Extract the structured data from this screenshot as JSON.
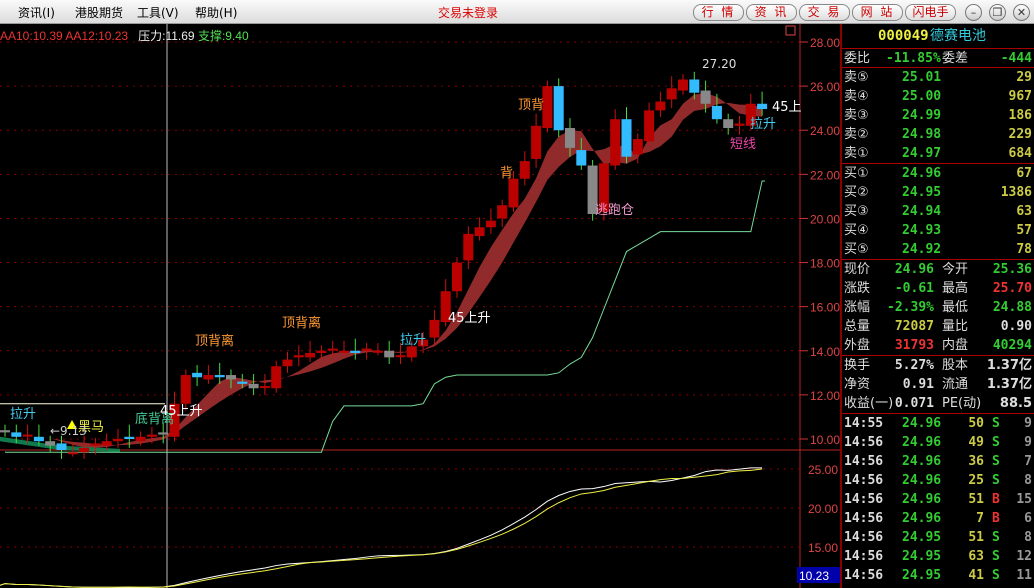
{
  "menu": [
    "资讯(I)",
    "港股期货",
    "工具(V)",
    "帮助(H)"
  ],
  "login_status": "交易未登录",
  "top_buttons": [
    "行 情",
    "资 讯",
    "交 易",
    "网 站",
    "闪电手"
  ],
  "window_buttons": [
    "minimize",
    "restore",
    "close"
  ],
  "legend": {
    "aa10": "AA10:10.39",
    "aa12": "AA12:10.23",
    "pressure": "压力:11.69",
    "support": "支撑:9.40"
  },
  "annotations": {
    "dingbeili1": "顶背离",
    "dingbeili2": "顶背离",
    "dingbeili3": "顶背",
    "dingbeili4": "顶背离",
    "dibeili": "底背离",
    "heima": "黑马",
    "low": "←9.13",
    "high": "27.20",
    "up45a": "45上升",
    "up45b": "45上升",
    "up45c": "45上",
    "lasheng1": "拉升",
    "lasheng2": "拉升",
    "lasheng3": "拉升",
    "duanxian": "短线",
    "taopao": "逃跑仓",
    "beibei": "背"
  },
  "chart_data": {
    "type": "candlestick",
    "closes": [
      10.3,
      10.1,
      10.2,
      9.9,
      9.7,
      9.5,
      9.4,
      9.6,
      9.8,
      9.9,
      10.0,
      10.0,
      10.1,
      10.2,
      10.2,
      11.6,
      12.9,
      12.8,
      12.9,
      12.8,
      12.7,
      12.5,
      12.3,
      12.4,
      13.3,
      13.6,
      13.8,
      13.9,
      14.0,
      14.1,
      14.0,
      13.9,
      14.1,
      14.0,
      13.7,
      13.8,
      14.2,
      14.5,
      15.4,
      16.7,
      18.0,
      19.3,
      19.6,
      19.9,
      20.6,
      21.8,
      22.6,
      24.2,
      26.0,
      24.0,
      23.2,
      22.4,
      20.2,
      22.5,
      24.5,
      22.8,
      23.6,
      24.9,
      25.3,
      25.9,
      26.3,
      25.7,
      25.2,
      24.5,
      24.1,
      24.3,
      25.2,
      24.96
    ],
    "price_ticks": [
      "28.00",
      "26.00",
      "24.00",
      "22.00",
      "20.00",
      "18.00",
      "16.00",
      "14.00",
      "12.00",
      "10.00"
    ],
    "price_range": [
      10,
      28
    ],
    "lower_ticks": [
      "25.00",
      "20.00",
      "15.00"
    ],
    "lower_current": "10.23"
  },
  "quote": {
    "code": "000049",
    "name": "德赛电池",
    "weibi_label": "委比",
    "weibi": "-11.85%",
    "weicha_label": "委差",
    "weicha": "-444",
    "sell": [
      [
        "卖⑤",
        "25.01",
        "29"
      ],
      [
        "卖④",
        "25.00",
        "967"
      ],
      [
        "卖③",
        "24.99",
        "186"
      ],
      [
        "卖②",
        "24.98",
        "229"
      ],
      [
        "卖①",
        "24.97",
        "684"
      ]
    ],
    "buy": [
      [
        "买①",
        "24.96",
        "67"
      ],
      [
        "买②",
        "24.95",
        "1386"
      ],
      [
        "买③",
        "24.94",
        "63"
      ],
      [
        "买④",
        "24.93",
        "57"
      ],
      [
        "买⑤",
        "24.92",
        "78"
      ]
    ],
    "stats": [
      [
        "现价",
        "24.96",
        "今开",
        "25.36"
      ],
      [
        "涨跌",
        "-0.61",
        "最高",
        "25.70"
      ],
      [
        "涨幅",
        "-2.39%",
        "最低",
        "24.88"
      ],
      [
        "总量",
        "72087",
        "量比",
        "0.90"
      ],
      [
        "外盘",
        "31793",
        "内盘",
        "40294"
      ]
    ],
    "stats2": [
      [
        "换手",
        "5.27%",
        "股本",
        "1.37亿"
      ],
      [
        "净资",
        "0.91",
        "流通",
        "1.37亿"
      ],
      [
        "收益(一)",
        "0.071",
        "PE(动)",
        "88.5"
      ]
    ],
    "ticks": [
      [
        "14:55",
        "24.96",
        "50",
        "S",
        "9"
      ],
      [
        "14:56",
        "24.96",
        "49",
        "S",
        "9"
      ],
      [
        "14:56",
        "24.96",
        "36",
        "S",
        "7"
      ],
      [
        "14:56",
        "24.96",
        "25",
        "S",
        "8"
      ],
      [
        "14:56",
        "24.96",
        "51",
        "B",
        "15"
      ],
      [
        "14:56",
        "24.96",
        "7",
        "B",
        "6"
      ],
      [
        "14:56",
        "24.95",
        "51",
        "S",
        "8"
      ],
      [
        "14:56",
        "24.95",
        "63",
        "S",
        "12"
      ],
      [
        "14:56",
        "24.95",
        "41",
        "S",
        "11"
      ]
    ]
  }
}
